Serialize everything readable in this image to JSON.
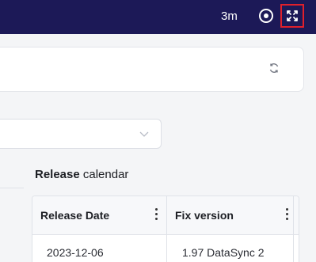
{
  "topbar": {
    "timer_text": "3m",
    "record_icon": "record-icon",
    "expand_icon": "expand-icon"
  },
  "search": {
    "refresh_icon": "refresh-icon"
  },
  "filter": {
    "chevron_icon": "chevron-down-icon"
  },
  "calendar": {
    "title_bold": "Release",
    "title_rest": " calendar",
    "columns": [
      "Release Date",
      "Fix version"
    ],
    "rows": [
      [
        "2023-12-06",
        "1.97 DataSync 2"
      ]
    ]
  },
  "colors": {
    "topbar": "#1c1957",
    "highlight": "#e0202b"
  }
}
